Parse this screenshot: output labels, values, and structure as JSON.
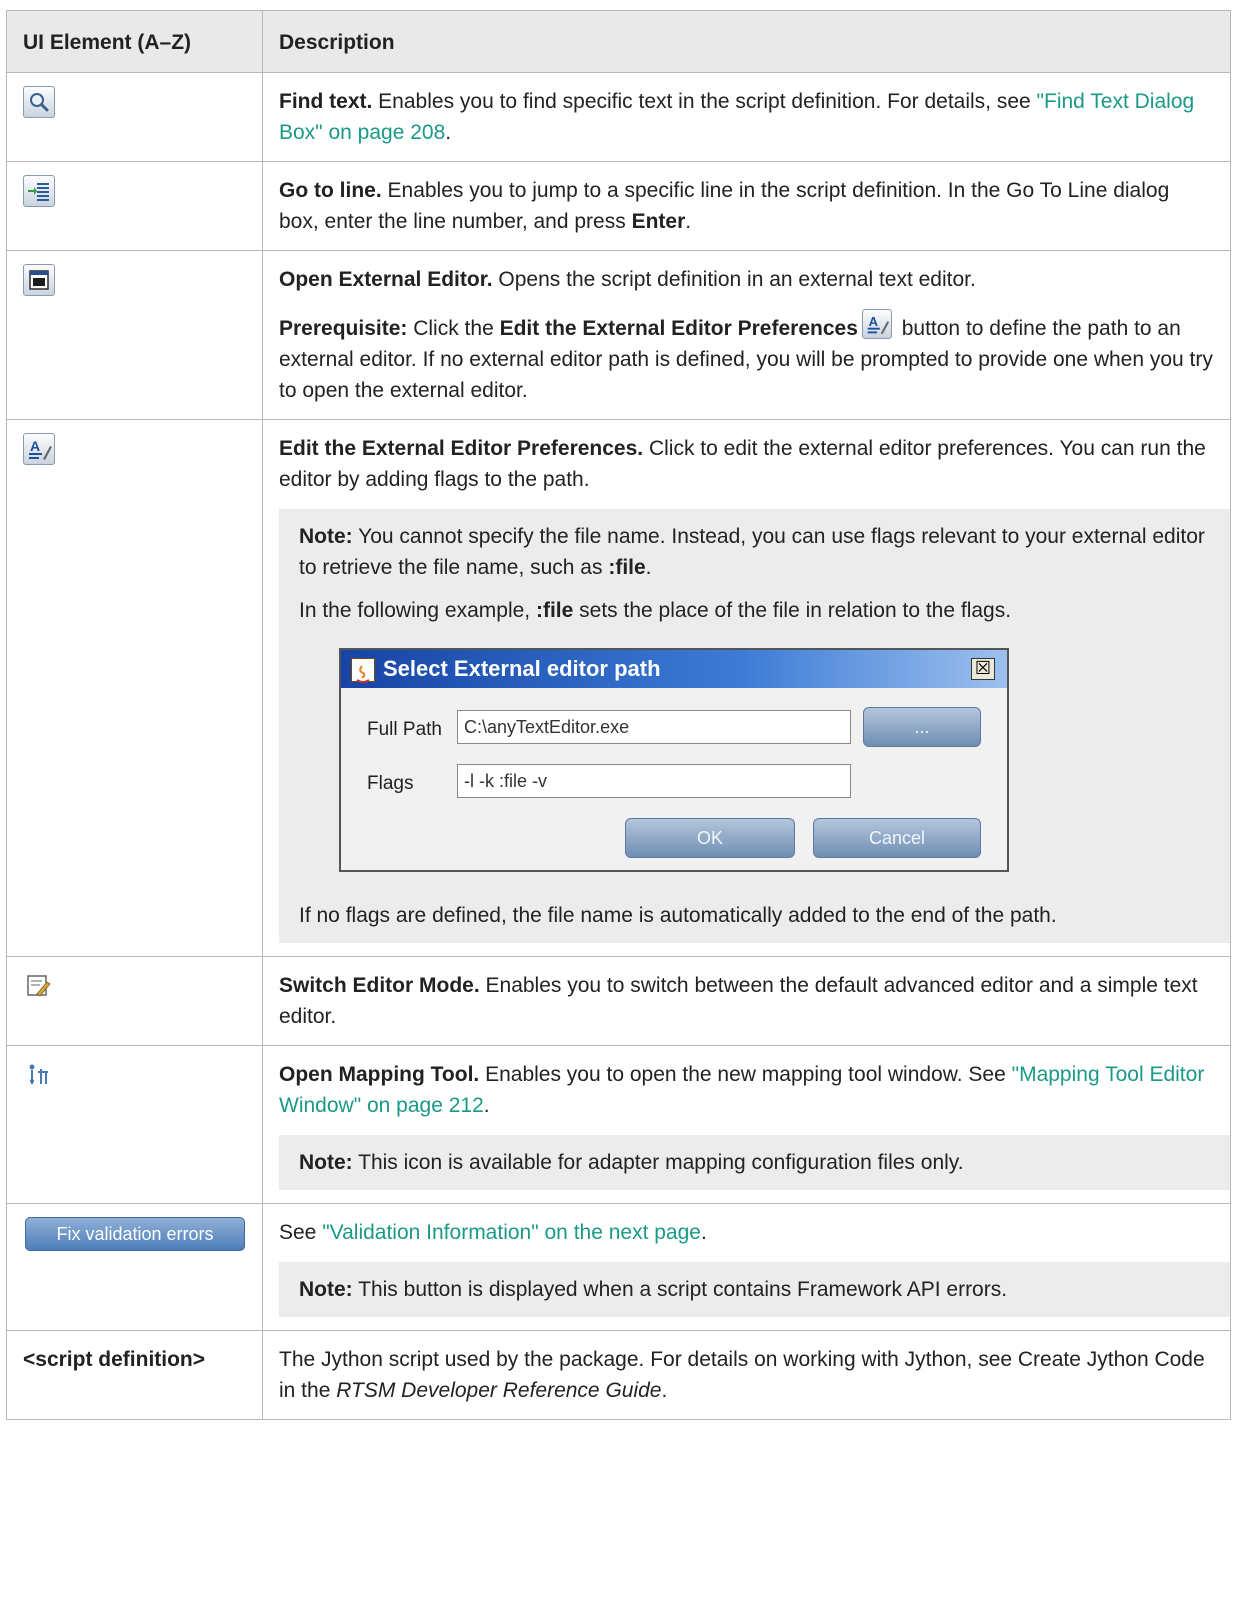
{
  "table": {
    "headers": [
      "UI Element (A–Z)",
      "Description"
    ]
  },
  "rows": {
    "find": {
      "icon": "magnifier-icon",
      "title": "Find text.",
      "text": " Enables you to find specific text in the script definition. For details, see ",
      "link": "\"Find Text Dialog Box\" on page 208",
      "end": "."
    },
    "goto": {
      "icon": "go-to-line-icon",
      "title": "Go to line.",
      "text": " Enables you to jump to a specific line in the script definition. In the Go To Line dialog box, enter the line number, and press ",
      "enter": "Enter",
      "end": "."
    },
    "external": {
      "icon": "open-external-editor-icon",
      "title": "Open External Editor.",
      "text": " Opens the script definition in an external text editor.",
      "prereq_label": "Prerequisite:",
      "prereq_text1": " Click the ",
      "prereq_bold": "Edit the External Editor Preferences",
      "prereq_text2": " button to define the path to an external editor. If no external editor path is defined, you will be prompted to provide one when you try to open the external editor."
    },
    "prefs": {
      "icon": "editor-preferences-icon",
      "title": "Edit the External Editor Preferences.",
      "text": " Click to edit the external editor preferences. You can run the editor by adding flags to the path.",
      "note_label": "Note:",
      "note_text1": " You cannot specify the file name. Instead, you can use flags relevant to your external editor to retrieve the file name, such as ",
      "note_bold": ":file",
      "note_end": ".",
      "example_text1": "In the following example, ",
      "example_bold": ":file",
      "example_text2": " sets the place of the file in relation to the flags.",
      "dialog": {
        "title": "Select External editor path",
        "close": "☒",
        "full_path_label": "Full Path",
        "full_path_value": "C:\\anyTextEditor.exe",
        "browse_label": "...",
        "flags_label": "Flags",
        "flags_value": "-l -k :file -v",
        "ok_label": "OK",
        "cancel_label": "Cancel"
      },
      "after": "If no flags are defined, the file name is automatically added to the end of the path."
    },
    "switch": {
      "icon": "switch-editor-mode-icon",
      "title": "Switch Editor Mode.",
      "text": " Enables you to switch between the default advanced editor and a simple text editor."
    },
    "mapping": {
      "icon": "mapping-tool-icon",
      "title": "Open Mapping Tool.",
      "text": " Enables you to open the new mapping tool window. See ",
      "link": "\"Mapping Tool Editor Window\" on page 212",
      "end": ".",
      "note_label": "Note:",
      "note_text": " This icon is available for adapter mapping configuration files only."
    },
    "fix": {
      "button_label": "Fix validation errors",
      "text": "See ",
      "link": "\"Validation Information\" on the next page",
      "end": ".",
      "note_label": "Note:",
      "note_text": " This button is displayed when a script contains Framework API errors."
    },
    "script": {
      "element": "<script definition>",
      "text": "The Jython script used by the package. For details on working with Jython, see Create Jython Code in the ",
      "italic": "RTSM Developer Reference Guide",
      "end": "."
    }
  },
  "colors": {
    "link": "#1a9a86",
    "header_bg": "#e9e9e9",
    "note_bg": "#ececec",
    "dialog_title_bar": "#1744a5"
  }
}
